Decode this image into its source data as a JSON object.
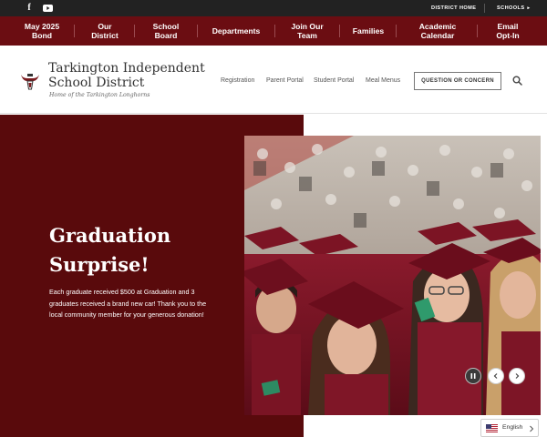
{
  "utility": {
    "social": [
      {
        "icon": "facebook-icon"
      },
      {
        "icon": "youtube-icon"
      }
    ],
    "district_home": "DISTRICT HOME",
    "schools": "SCHOOLS"
  },
  "nav": {
    "items": [
      {
        "line1": "May 2025",
        "line2": "Bond"
      },
      {
        "line1": "Our",
        "line2": "District"
      },
      {
        "line1": "School",
        "line2": "Board"
      },
      {
        "line1": "Departments",
        "line2": ""
      },
      {
        "line1": "Join Our",
        "line2": "Team"
      },
      {
        "line1": "Families",
        "line2": ""
      },
      {
        "line1": "Academic",
        "line2": "Calendar"
      },
      {
        "line1": "Email",
        "line2": "Opt-In"
      }
    ]
  },
  "header": {
    "name_line1": "Tarkington Independent",
    "name_line2": "School District",
    "tagline": "Home of the Tarkington Longhorns",
    "links": [
      "Registration",
      "Parent Portal",
      "Student Portal",
      "Meal Menus"
    ],
    "question_button": "QUESTION OR CONCERN"
  },
  "hero": {
    "title_line1": "Graduation",
    "title_line2": "Surprise!",
    "text": "Each graduate received $500 at Graduation and 3 graduates received a brand new car! Thank you to the local community member for your generous donation!"
  },
  "language": {
    "label": "English"
  },
  "colors": {
    "maroon_nav": "#6b0d12",
    "maroon_hero": "#590a0c",
    "utility_bar": "#222222"
  }
}
